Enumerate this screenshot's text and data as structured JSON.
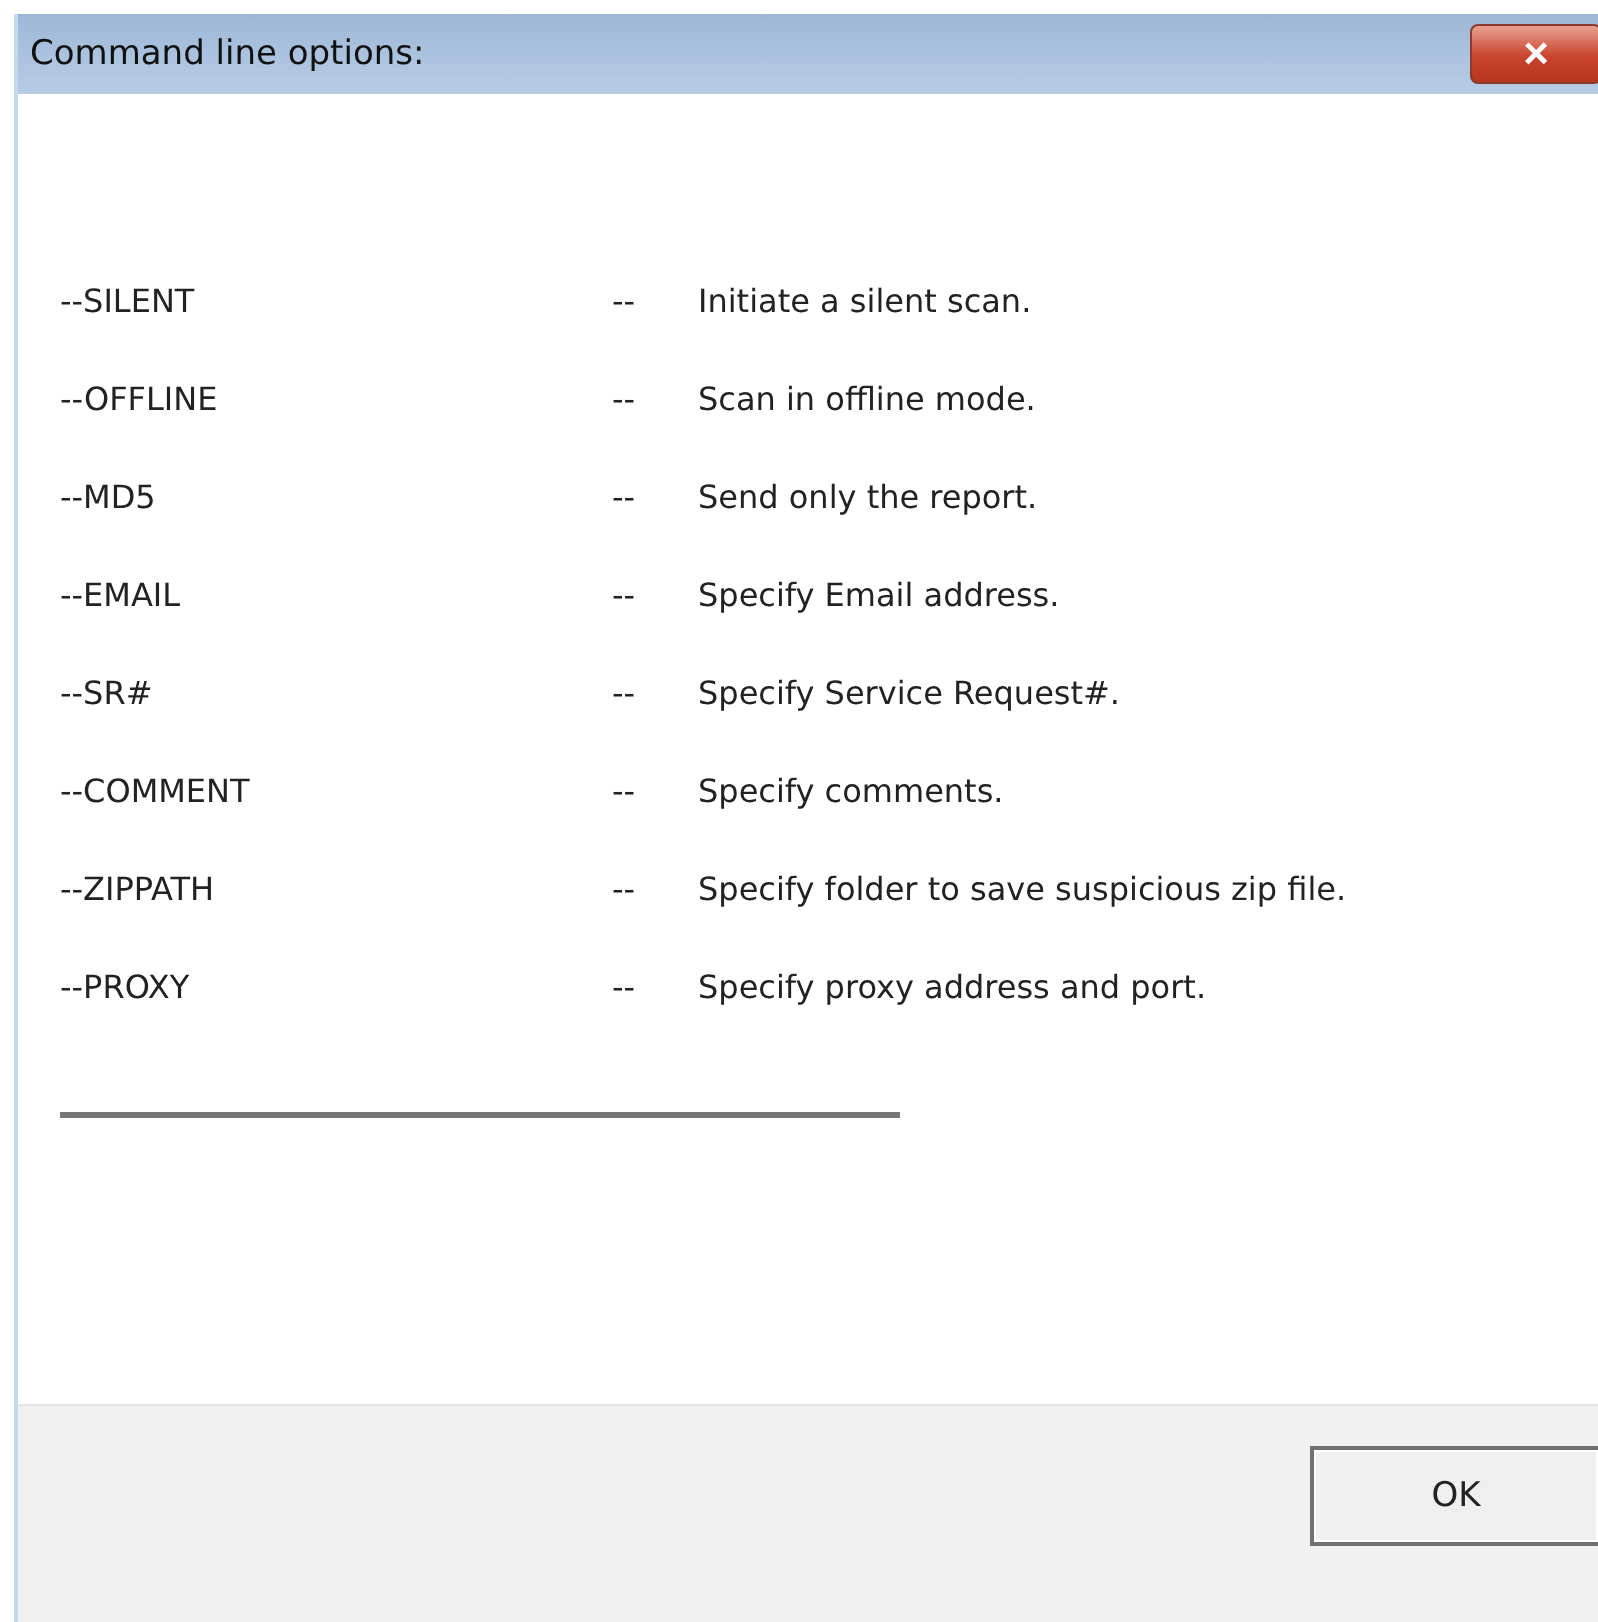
{
  "window": {
    "title": "Command line options:",
    "close": "×"
  },
  "options": [
    {
      "option": "--SILENT",
      "separator": "--",
      "description": "Initiate a silent scan."
    },
    {
      "option": "--OFFLINE",
      "separator": "--",
      "description": "Scan in offline mode."
    },
    {
      "option": "--MD5",
      "separator": "--",
      "description": "Send only the report."
    },
    {
      "option": "--EMAIL",
      "separator": "--",
      "description": "Specify Email address."
    },
    {
      "option": "--SR#",
      "separator": "--",
      "description": "Specify Service Request#."
    },
    {
      "option": "--COMMENT",
      "separator": "--",
      "description": "Specify comments."
    },
    {
      "option": "--ZIPPATH",
      "separator": "--",
      "description": "Specify folder to save suspicious zip file."
    },
    {
      "option": "--PROXY",
      "separator": "--",
      "description": "Specify proxy address and port."
    }
  ],
  "buttons": [
    "OK"
  ]
}
